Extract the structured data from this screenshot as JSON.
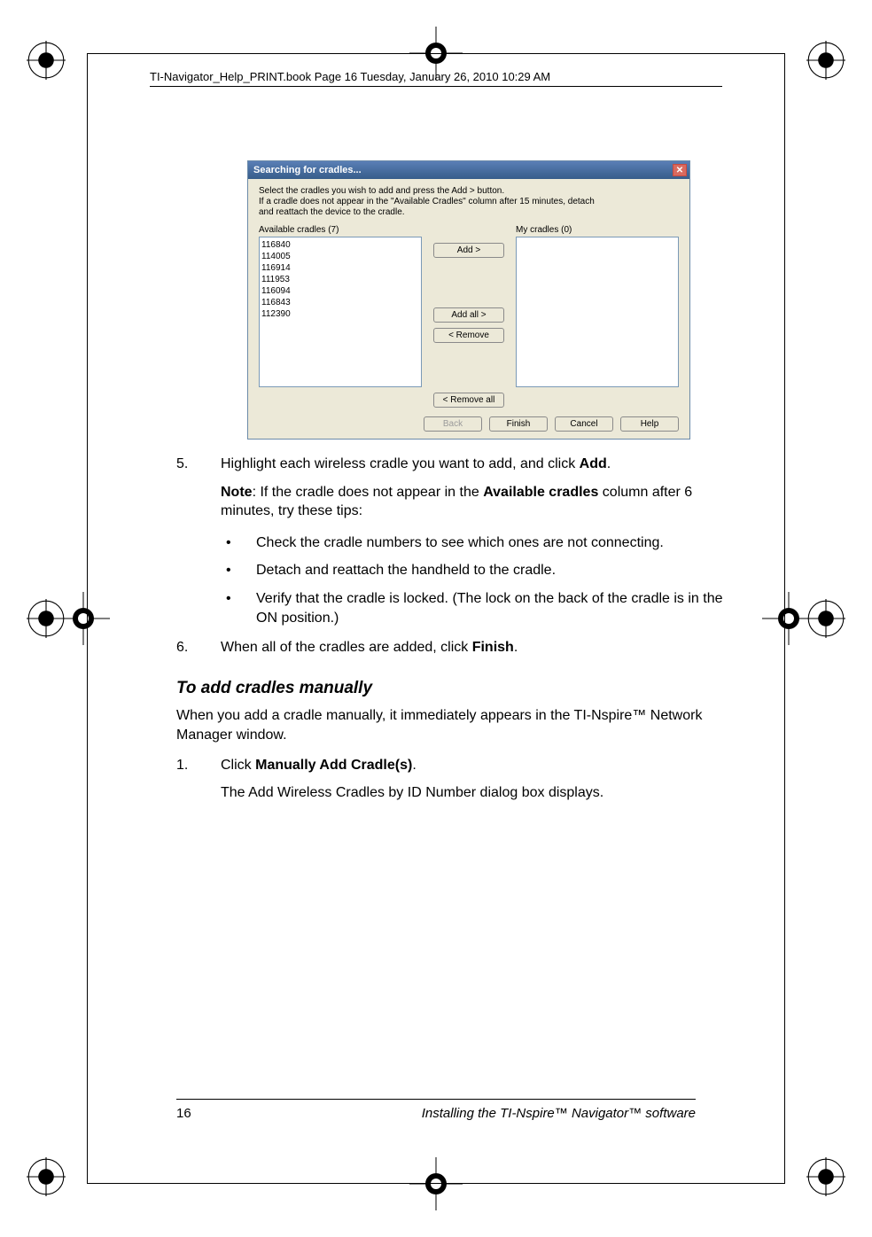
{
  "header": {
    "text": "TI-Navigator_Help_PRINT.book  Page 16  Tuesday, January 26, 2010  10:29 AM"
  },
  "dialog": {
    "title": "Searching for cradles...",
    "close_glyph": "✕",
    "instructions_line1": "Select the cradles you wish to add and press the Add > button.",
    "instructions_line2": "If a cradle does not appear in the \"Available Cradles\" column after 15 minutes, detach",
    "instructions_line3": "and reattach the device to the cradle.",
    "available_label": "Available cradles (7)",
    "my_label": "My cradles (0)",
    "available_items": [
      "116840",
      "114005",
      "116914",
      "111953",
      "116094",
      "116843",
      "112390"
    ],
    "buttons": {
      "add": "Add >",
      "add_all": "Add all >",
      "remove": "< Remove",
      "remove_all": "< Remove all",
      "back": "Back",
      "finish": "Finish",
      "cancel": "Cancel",
      "help": "Help"
    }
  },
  "steps": {
    "s5_num": "5.",
    "s5_text_a": "Highlight each wireless cradle you want to add, and click ",
    "s5_text_b": "Add",
    "s5_text_c": ".",
    "note_a": "Note",
    "note_b": ": If the cradle does not appear in the ",
    "note_c": "Available cradles",
    "note_d": " column after 6 minutes, try these tips:",
    "bullet1": "Check the cradle numbers to see which ones are not connecting.",
    "bullet2": "Detach and reattach the handheld to the cradle.",
    "bullet3": "Verify that the cradle is locked. (The lock on the back of the cradle is in the ON position.)",
    "s6_num": "6.",
    "s6_a": "When all of the cradles are added, click ",
    "s6_b": "Finish",
    "s6_c": ".",
    "heading": "To add cradles manually",
    "para1": "When you add a cradle manually, it immediately appears in the TI-Nspire™ Network Manager window.",
    "s1_num": "1.",
    "s1_a": "Click ",
    "s1_b": "Manually Add Cradle(s)",
    "s1_c": ".",
    "s1_sub": "The Add Wireless Cradles by ID Number dialog box displays."
  },
  "footer": {
    "page": "16",
    "title": "Installing the TI-Nspire™ Navigator™ software"
  }
}
